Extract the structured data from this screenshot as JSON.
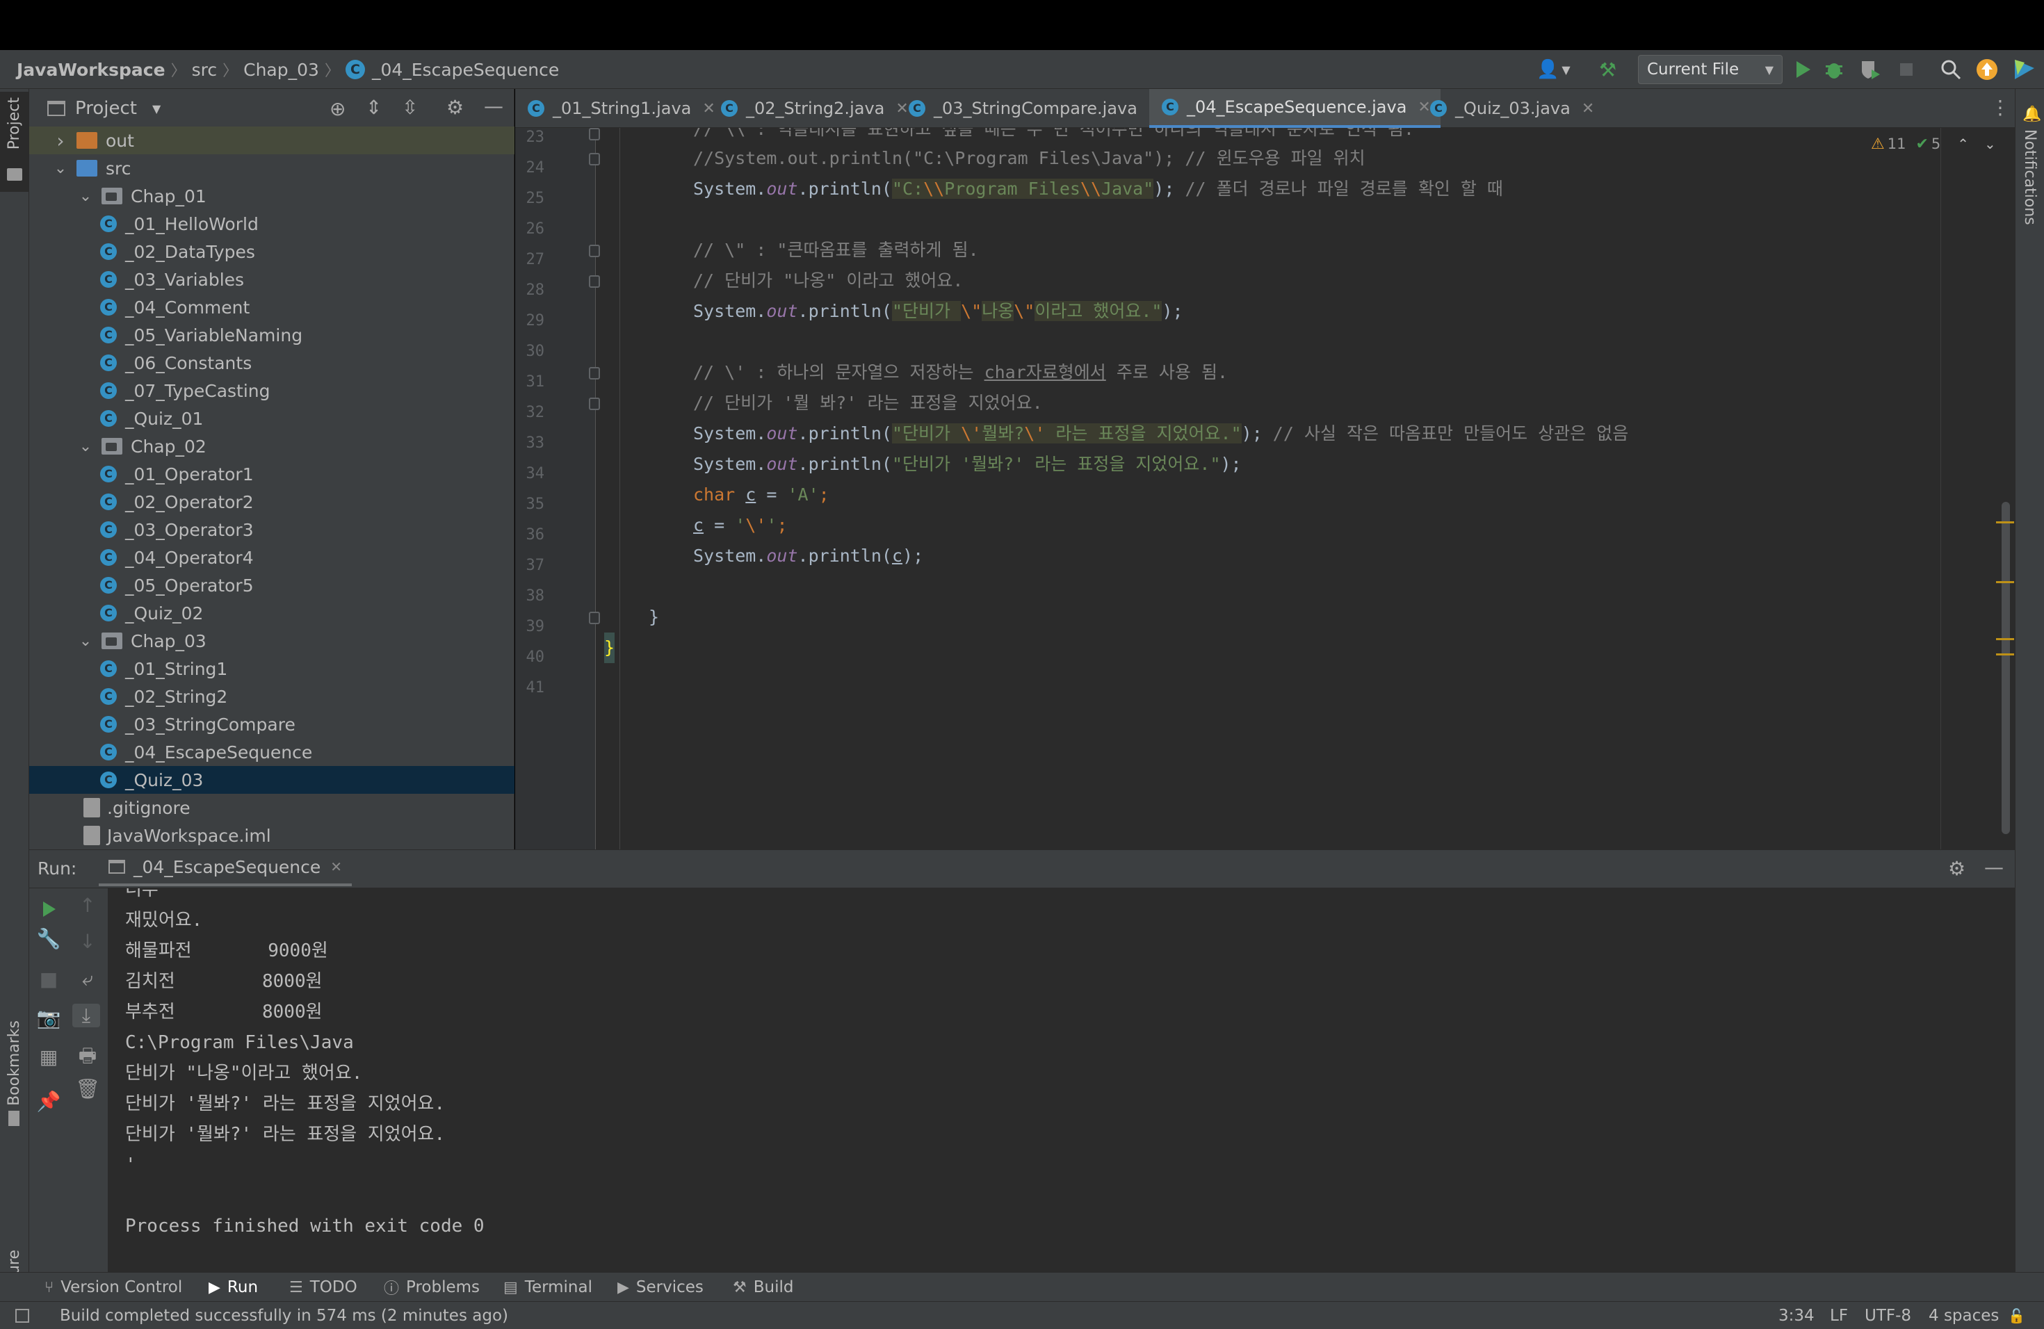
{
  "breadcrumb": [
    "JavaWorkspace",
    "src",
    "Chap_03",
    "_04_EscapeSequence"
  ],
  "toolbar": {
    "run_config": "Current File"
  },
  "project_panel": {
    "title": "Project",
    "tree": [
      {
        "label": "out",
        "type": "folder-orange",
        "depth": 0,
        "arrow": "›"
      },
      {
        "label": "src",
        "type": "folder-blue",
        "depth": 0,
        "arrow": "⌄"
      },
      {
        "label": "Chap_01",
        "type": "package",
        "depth": 1,
        "arrow": "⌄"
      },
      {
        "label": "_01_HelloWorld",
        "type": "class",
        "depth": 2
      },
      {
        "label": "_02_DataTypes",
        "type": "class",
        "depth": 2
      },
      {
        "label": "_03_Variables",
        "type": "class",
        "depth": 2
      },
      {
        "label": "_04_Comment",
        "type": "class",
        "depth": 2
      },
      {
        "label": "_05_VariableNaming",
        "type": "class",
        "depth": 2
      },
      {
        "label": "_06_Constants",
        "type": "class",
        "depth": 2
      },
      {
        "label": "_07_TypeCasting",
        "type": "class",
        "depth": 2
      },
      {
        "label": "_Quiz_01",
        "type": "class",
        "depth": 2
      },
      {
        "label": "Chap_02",
        "type": "package",
        "depth": 1,
        "arrow": "⌄"
      },
      {
        "label": "_01_Operator1",
        "type": "class",
        "depth": 2
      },
      {
        "label": "_02_Operator2",
        "type": "class",
        "depth": 2
      },
      {
        "label": "_03_Operator3",
        "type": "class",
        "depth": 2
      },
      {
        "label": "_04_Operator4",
        "type": "class",
        "depth": 2
      },
      {
        "label": "_05_Operator5",
        "type": "class",
        "depth": 2
      },
      {
        "label": "_Quiz_02",
        "type": "class",
        "depth": 2
      },
      {
        "label": "Chap_03",
        "type": "package",
        "depth": 1,
        "arrow": "⌄"
      },
      {
        "label": "_01_String1",
        "type": "class",
        "depth": 2
      },
      {
        "label": "_02_String2",
        "type": "class",
        "depth": 2
      },
      {
        "label": "_03_StringCompare",
        "type": "class",
        "depth": 2
      },
      {
        "label": "_04_EscapeSequence",
        "type": "class",
        "depth": 2
      },
      {
        "label": "_Quiz_03",
        "type": "class",
        "depth": 2,
        "selected": true
      },
      {
        "label": ".gitignore",
        "type": "file",
        "depth": 0
      },
      {
        "label": "JavaWorkspace.iml",
        "type": "file",
        "depth": 0
      }
    ]
  },
  "editor_tabs": [
    {
      "label": "_01_String1.java"
    },
    {
      "label": "_02_String2.java"
    },
    {
      "label": "_03_StringCompare.java"
    },
    {
      "label": "_04_EscapeSequence.java",
      "active": true
    },
    {
      "label": "_Quiz_03.java"
    }
  ],
  "inspections": {
    "warnings": "11",
    "checks": "5"
  },
  "line_numbers": [
    "23",
    "24",
    "25",
    "26",
    "27",
    "28",
    "29",
    "30",
    "31",
    "32",
    "33",
    "34",
    "35",
    "36",
    "37",
    "38",
    "39",
    "40",
    "41"
  ],
  "code": {
    "l23": "// \\\\ : 역슬래시를 표현하고 싶을 때는 두 번 적어주면 하나의 역슬래시 문자로 인식 됨.",
    "l24": "//System.out.println(\"C:\\Program Files\\Java\"); // 윈도우용 파일 위치",
    "l25_a": "System.",
    "l25_out": "out",
    "l25_b": ".println(",
    "l25_s1": "\"C:",
    "l25_e1": "\\\\",
    "l25_s2": "Program Files",
    "l25_e2": "\\\\",
    "l25_s3": "Java\"",
    "l25_c": "); ",
    "l25_cm": "// 폴더 경로나 파일 경로를 확인 할 때",
    "l27": "// \\\" : \"큰따옴표를 출력하게 됨.",
    "l28": "// 단비가 \"나옹\" 이라고 했어요.",
    "l29_a": "System.",
    "l29_out": "out",
    "l29_b": ".println(",
    "l29_s1": "\"단비가 ",
    "l29_e1": "\\\"",
    "l29_s2": "나옹",
    "l29_e2": "\\\"",
    "l29_s3": "이라고 했어요.\"",
    "l29_c": ");",
    "l31_a": "// \\' : 하나의 문자열으 저장하는 ",
    "l31_u": "char자료형에서",
    "l31_b": " 주로 사용 됨.",
    "l32": "// 단비가 '뭘 봐?' 라는 표정을 지었어요.",
    "l33_a": "System.",
    "l33_out": "out",
    "l33_b": ".println(",
    "l33_s1": "\"단비가 ",
    "l33_e1": "\\'",
    "l33_s2": "뭘봐?",
    "l33_e2": "\\'",
    "l33_s3": " 라는 표정을 지었어요.\"",
    "l33_c": "); ",
    "l33_cm": "// 사실 작은 따옴표만 만들어도 상관은 없음",
    "l34_a": "System.",
    "l34_out": "out",
    "l34_b": ".println(",
    "l34_s": "\"단비가 '뭘봐?' 라는 표정을 지었어요.\"",
    "l34_c": ");",
    "l35_kw": "char ",
    "l35_v": "c",
    "l35_b": " = ",
    "l35_s": "'A'",
    "l35_c": ";",
    "l36_v": "c",
    "l36_b": " = ",
    "l36_s1": "'",
    "l36_e": "\\'",
    "l36_s2": "'",
    "l36_c": ";",
    "l37_a": "System.",
    "l37_out": "out",
    "l37_b": ".println(",
    "l37_v": "c",
    "l37_c": ");",
    "l39": "}",
    "l40": "}"
  },
  "run_panel": {
    "label": "Run:",
    "tab": "_04_EscapeSequence",
    "output": [
      "너무",
      "재밌어요.",
      "해물파전       9000원",
      "김치전        8000원",
      "부추전        8000원",
      "C:\\Program Files\\Java",
      "단비가 \"나옹\"이라고 했어요.",
      "단비가 '뭘봐?' 라는 표정을 지었어요.",
      "단비가 '뭘봐?' 라는 표정을 지었어요.",
      "'",
      "",
      "Process finished with exit code 0"
    ]
  },
  "side_labels": {
    "project": "Project",
    "bookmarks": "Bookmarks",
    "structure": "Structure",
    "notifications": "Notifications"
  },
  "bottom_tools": [
    "Version Control",
    "Run",
    "TODO",
    "Problems",
    "Terminal",
    "Services",
    "Build"
  ],
  "status": {
    "message": "Build completed successfully in 574 ms (2 minutes ago)",
    "position": "3:34",
    "line_sep": "LF",
    "encoding": "UTF-8",
    "indent": "4 spaces"
  },
  "colors": {
    "accent": "#4a88c7",
    "run_green": "#499c54",
    "bg_editor": "#2b2b2b",
    "bg_panel": "#3c3f41"
  }
}
